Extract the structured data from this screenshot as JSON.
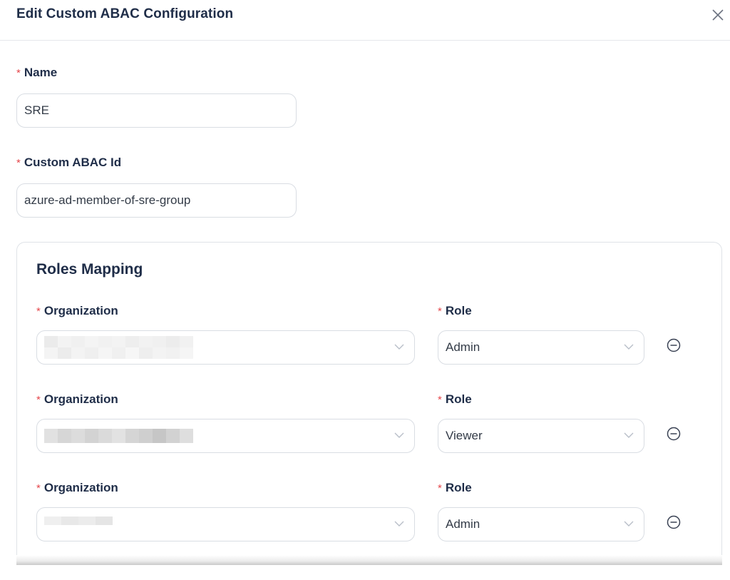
{
  "dialog": {
    "title": "Edit Custom ABAC Configuration",
    "close_icon": "close-icon"
  },
  "form": {
    "required_mark": "*",
    "name": {
      "label": "Name",
      "value": "SRE"
    },
    "custom_abac_id": {
      "label": "Custom ABAC Id",
      "value": "azure-ad-member-of-sre-group"
    }
  },
  "roles_mapping": {
    "title": "Roles Mapping",
    "rows": [
      {
        "organization_label": "Organization",
        "organization_value": "",
        "organization_redacted": true,
        "role_label": "Role",
        "role_value": "Admin"
      },
      {
        "organization_label": "Organization",
        "organization_value": "",
        "organization_redacted": true,
        "role_label": "Role",
        "role_value": "Viewer"
      },
      {
        "organization_label": "Organization",
        "organization_value": "",
        "organization_redacted": true,
        "role_label": "Role",
        "role_value": "Admin"
      }
    ]
  },
  "colors": {
    "heading": "#1f2d48",
    "required": "#e5484d",
    "border": "#d9dde3",
    "icon": "#8a94a6"
  }
}
